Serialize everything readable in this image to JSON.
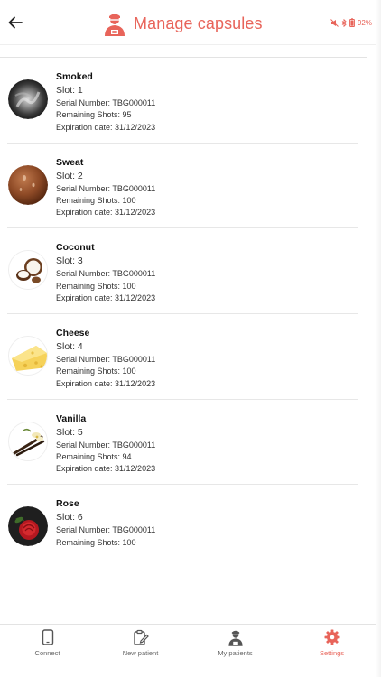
{
  "header": {
    "title": "Manage capsules",
    "battery": "92%"
  },
  "colors": {
    "accent": "#e8645a",
    "text": "#222222",
    "divider": "#e7e7e7"
  },
  "capsules": [
    {
      "name": "Smoked",
      "slot": "Slot: 1",
      "serial": "Serial Number: TBG000011",
      "shots": "Remaining Shots: 95",
      "expiry": "Expiration date: 31/12/2023",
      "image": "smoke-image"
    },
    {
      "name": "Sweat",
      "slot": "Slot: 2",
      "serial": "Serial Number: TBG000011",
      "shots": "Remaining Shots: 100",
      "expiry": "Expiration date: 31/12/2023",
      "image": "sweat-image"
    },
    {
      "name": "Coconut",
      "slot": "Slot: 3",
      "serial": "Serial Number: TBG000011",
      "shots": "Remaining Shots: 100",
      "expiry": "Expiration date: 31/12/2023",
      "image": "coconut-image"
    },
    {
      "name": "Cheese",
      "slot": "Slot: 4",
      "serial": "Serial Number: TBG000011",
      "shots": "Remaining Shots: 100",
      "expiry": "Expiration date: 31/12/2023",
      "image": "cheese-image"
    },
    {
      "name": "Vanilla",
      "slot": "Slot: 5",
      "serial": "Serial Number: TBG000011",
      "shots": "Remaining Shots: 94",
      "expiry": "Expiration date: 31/12/2023",
      "image": "vanilla-image"
    },
    {
      "name": "Rose",
      "slot": "Slot: 6",
      "serial": "Serial Number: TBG000011",
      "shots": "Remaining Shots: 100",
      "image": "rose-image"
    }
  ],
  "nav": [
    {
      "label": "Connect",
      "icon": "phone-icon"
    },
    {
      "label": "New patient",
      "icon": "clipboard-edit-icon"
    },
    {
      "label": "My patients",
      "icon": "doctor-icon"
    },
    {
      "label": "Settings",
      "icon": "gear-icon",
      "active": true
    }
  ]
}
